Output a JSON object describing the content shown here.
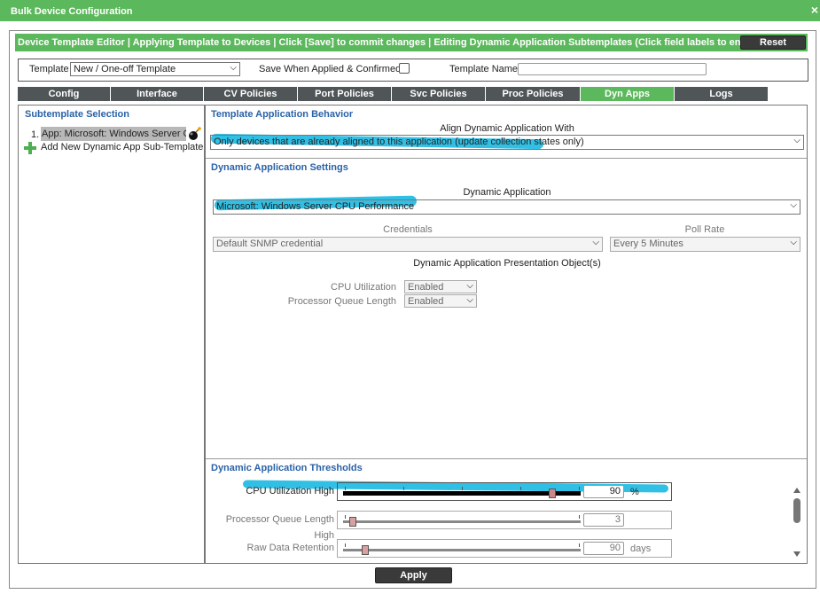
{
  "window": {
    "title": "Bulk Device Configuration",
    "close": "×"
  },
  "editor": {
    "header": "Device Template Editor | Applying Template to Devices | Click [Save] to commit changes | Editing Dynamic Application Subtemplates (Click field labels to enable/dis",
    "reset_label": "Reset"
  },
  "template_bar": {
    "template_label": "Template",
    "template_value": "New / One-off Template",
    "save_label": "Save When Applied & Confirmed",
    "name_label": "Template Name",
    "name_value": ""
  },
  "tabs": [
    {
      "label": "Config"
    },
    {
      "label": "Interface"
    },
    {
      "label": "CV Policies"
    },
    {
      "label": "Port Policies"
    },
    {
      "label": "Svc Policies"
    },
    {
      "label": "Proc Policies"
    },
    {
      "label": "Dyn Apps"
    },
    {
      "label": "Logs"
    }
  ],
  "left": {
    "title": "Subtemplate Selection",
    "item_index": "1.",
    "item_label": "App: Microsoft: Windows Server C",
    "add_label": "Add New Dynamic App Sub-Template"
  },
  "behavior": {
    "title": "Template Application Behavior",
    "align_label": "Align Dynamic Application With",
    "align_value": "Only devices that are already aligned to this application (update collection states only)"
  },
  "settings": {
    "title": "Dynamic Application Settings",
    "app_label": "Dynamic Application",
    "app_value": "Microsoft: Windows Server CPU Performance",
    "cred_label": "Credentials",
    "cred_value": "Default SNMP credential",
    "poll_label": "Poll Rate",
    "poll_value": "Every 5 Minutes",
    "objects_title": "Dynamic Application Presentation Object(s)",
    "objects": [
      {
        "label": "CPU Utilization",
        "value": "Enabled"
      },
      {
        "label": "Processor Queue Length",
        "value": "Enabled"
      }
    ]
  },
  "thresholds": {
    "title": "Dynamic Application Thresholds",
    "items": [
      {
        "label": "CPU Utilization High",
        "value": "90",
        "unit": "%",
        "level": 0.9
      },
      {
        "label": "Processor Queue Length",
        "label2": "High",
        "value": "3",
        "unit": "",
        "level": 0.03
      },
      {
        "label": "Raw Data Retention",
        "value": "90",
        "unit": "days",
        "level": 0.1
      }
    ]
  },
  "footer": {
    "apply_label": "Apply"
  }
}
